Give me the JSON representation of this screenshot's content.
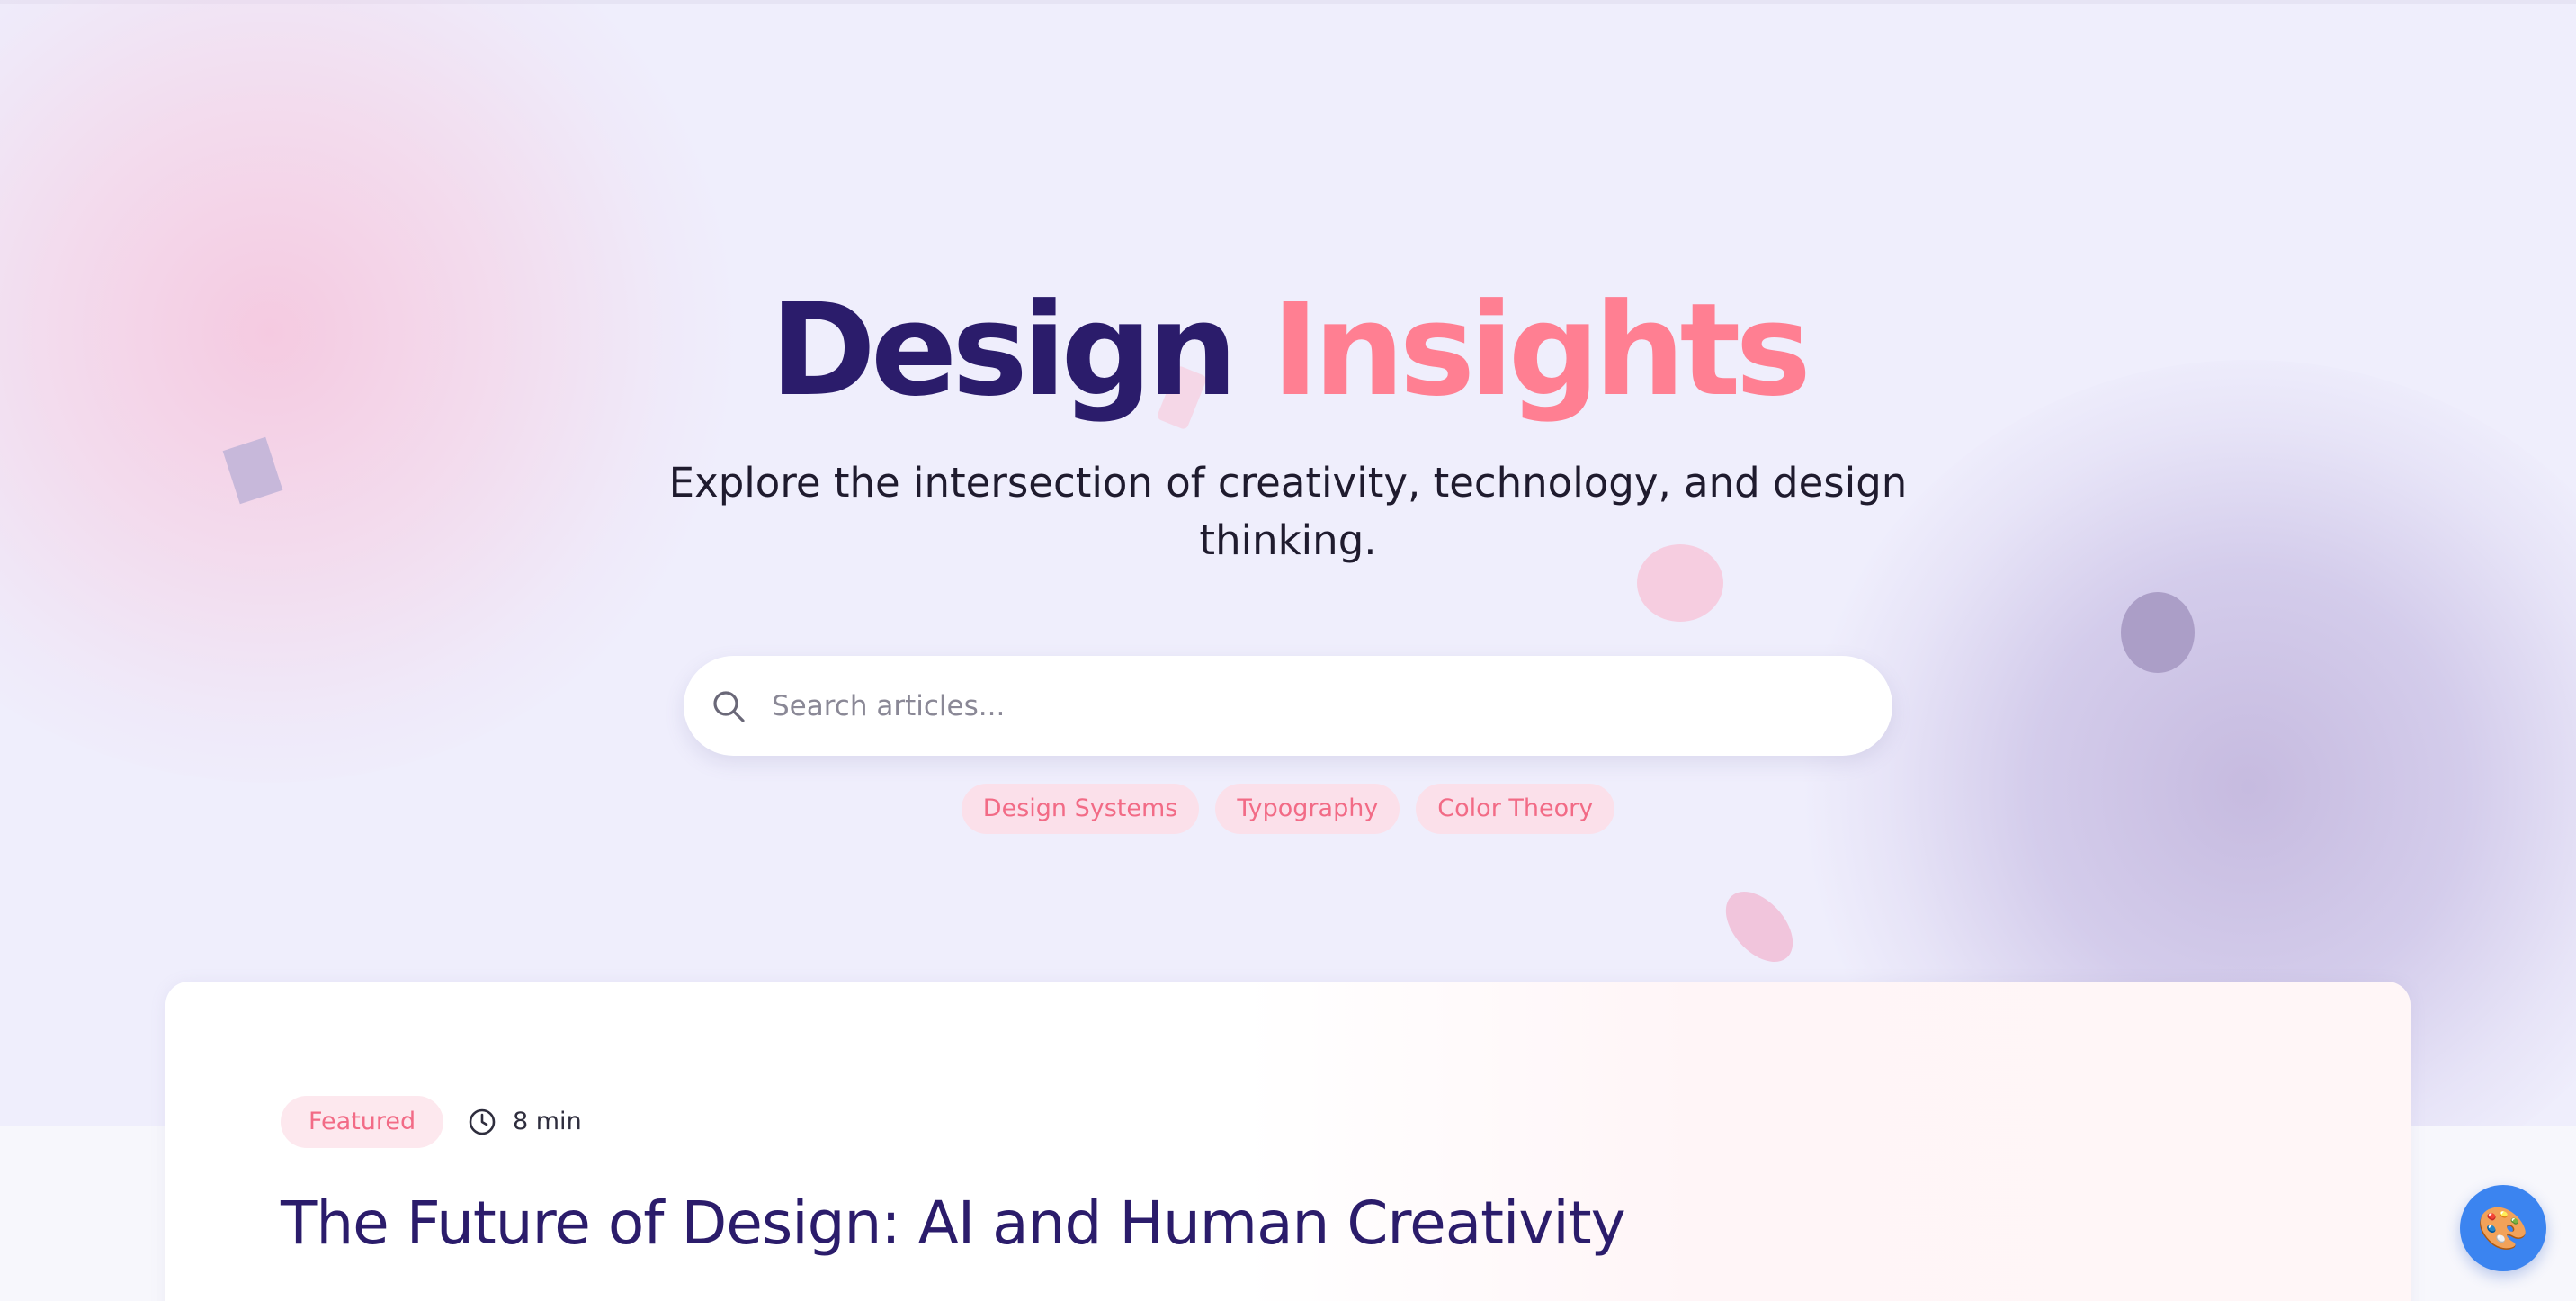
{
  "hero": {
    "title_part1": "Design",
    "title_part2": "Insights",
    "subtitle": "Explore the intersection of creativity, technology, and design thinking.",
    "search": {
      "placeholder": "Search articles...",
      "icon": "search-icon"
    },
    "tags": [
      "Design Systems",
      "Typography",
      "Color Theory"
    ]
  },
  "featured_card": {
    "badge": "Featured",
    "clock_icon": "clock-icon",
    "read_time": "8 min",
    "title": "The Future of Design: AI and Human Creativity"
  },
  "fab": {
    "icon": "palette-icon",
    "glyph": "🎨"
  },
  "colors": {
    "primary_dark": "#2b1c6b",
    "accent_pink": "#ff7f92",
    "tag_bg": "#fbe0ea",
    "tag_text": "#f26b86",
    "hero_bg": "#efeefc",
    "fab_blue": "#3b84f0"
  }
}
